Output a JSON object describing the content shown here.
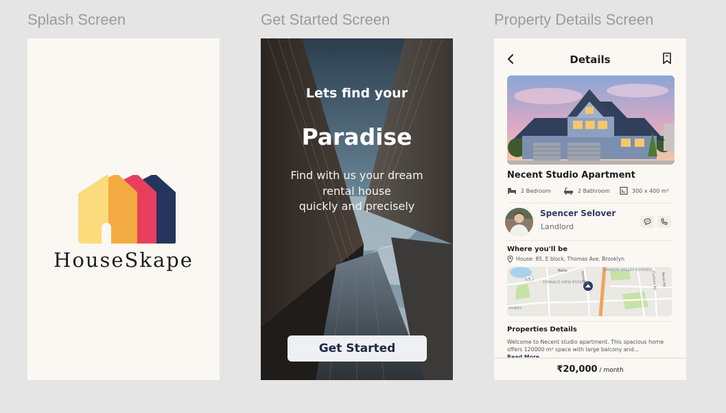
{
  "frames": {
    "splash_label": "Splash Screen",
    "getstarted_label": "Get Started Screen",
    "details_label": "Property Details Screen"
  },
  "splash": {
    "brand": "HouseSkape",
    "logo_colors": [
      "#fbdb7c",
      "#f3ab41",
      "#e83f5e",
      "#25355c"
    ]
  },
  "get_started": {
    "line1": "Lets find your",
    "line2": "Paradise",
    "desc_lines": [
      "Find with us your dream",
      "rental house",
      "quickly and precisely"
    ],
    "button_label": "Get Started"
  },
  "details": {
    "title": "Details",
    "back_icon": "chevron-left-icon",
    "bookmark_icon": "bookmark-icon",
    "property_name": "Necent Studio Apartment",
    "features": [
      {
        "icon": "bed-icon",
        "label": "2 Bedroom"
      },
      {
        "icon": "bathtub-icon",
        "label": "2 Bathroom"
      },
      {
        "icon": "area-icon",
        "label": "300 x 400 m²"
      }
    ],
    "agent": {
      "name": "Spencer Selover",
      "role": "Landlord"
    },
    "where_title": "Where you'll be",
    "address": "House: 85, E block, Thomas Ave, Brooklyn",
    "map_labels": [
      "TERRACE VIEW ESTATES",
      "HARBOR VALLEY ESTATES",
      "Bella",
      "Thomas Ave",
      "Chatham Rd",
      "Perros Rd",
      "176",
      "IPHREY"
    ],
    "props_title": "Properties Details",
    "desc_line1": "Welcome to Necent studio apartment. This spacious home",
    "desc_line2": "offers 120000 m² space with large balcony and...",
    "read_more": "Read More",
    "price": "₹20,000",
    "per": "/ month"
  },
  "colors": {
    "background": "#e5e5e5",
    "card": "#fbf8f3",
    "navy": "#2e3b66",
    "label_grey": "#9b9b9b"
  }
}
